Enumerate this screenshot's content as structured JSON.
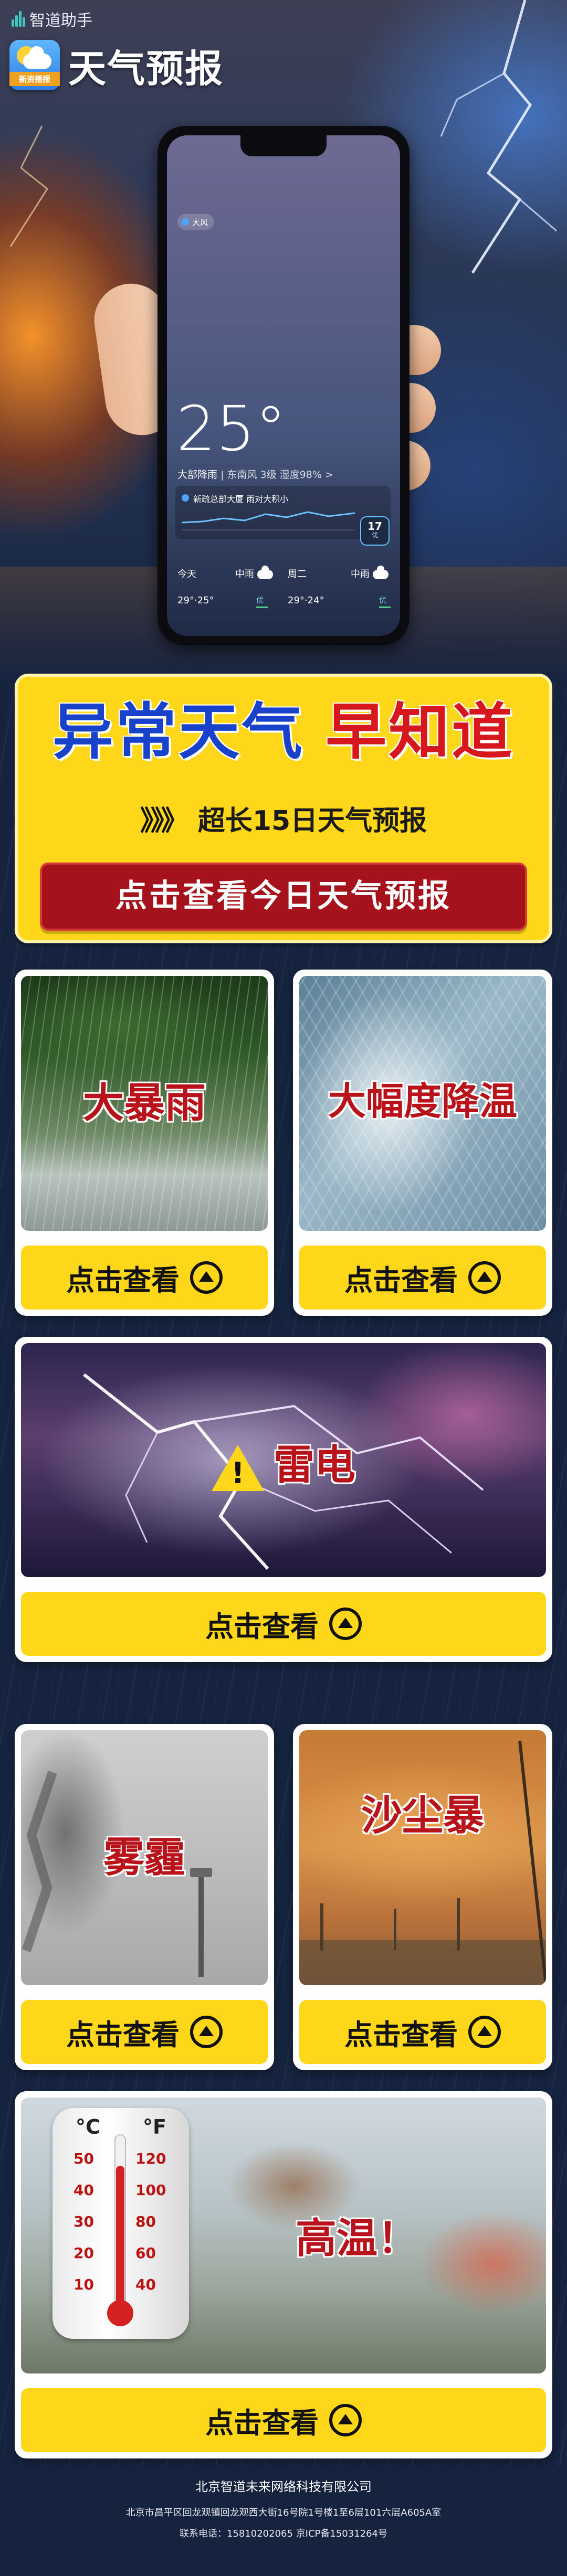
{
  "top_bar": {
    "brand": "智道助手"
  },
  "app": {
    "badge_text": "新资播报",
    "title": "天气预报"
  },
  "phone": {
    "location": "大风",
    "temperature": "25°",
    "condition": "大部降雨",
    "condition_detail": "| 东南风 3级  湿度98% >",
    "alert_text": "新疏总部大厦   雨对大积小",
    "aqi_value": "17",
    "aqi_label": "优",
    "forecast": {
      "days": [
        "今天",
        "中雨",
        "周二",
        "中雨"
      ],
      "temps": [
        "29°·25°",
        "优",
        "29°·24°",
        "优"
      ]
    }
  },
  "banner": {
    "headline_part1": "异常天气",
    "headline_part2": "早知道",
    "subtitle_arrows": "》》》",
    "subtitle": "超长15日天气预报",
    "button": "点击查看今日天气预报"
  },
  "cards": [
    {
      "title": "大暴雨",
      "button": "点击查看"
    },
    {
      "title": "大幅度降温",
      "button": "点击查看"
    },
    {
      "title": "雷电",
      "button": "点击查看"
    },
    {
      "title": "雾霾",
      "button": "点击查看"
    },
    {
      "title": "沙尘暴",
      "button": "点击查看"
    },
    {
      "title": "高温！",
      "button": "点击查看"
    }
  ],
  "thermometer": {
    "unit_c": "°C",
    "unit_f": "°F",
    "celsius_ticks": [
      "50",
      "40",
      "30",
      "20",
      "10"
    ],
    "fahrenheit_ticks": [
      "120",
      "100",
      "80",
      "60",
      "40"
    ]
  },
  "footer": {
    "company": "北京智道未来网络科技有限公司",
    "address": "北京市昌平区回龙观镇回龙观西大街16号院1号楼1至6层101六层A605A室",
    "contact": "联系电话：15810202065   京ICP备15031264号"
  },
  "colors": {
    "accent_yellow": "#ffd71a",
    "accent_red": "#b8121a",
    "accent_blue": "#1742c9",
    "background": "#16233f"
  }
}
